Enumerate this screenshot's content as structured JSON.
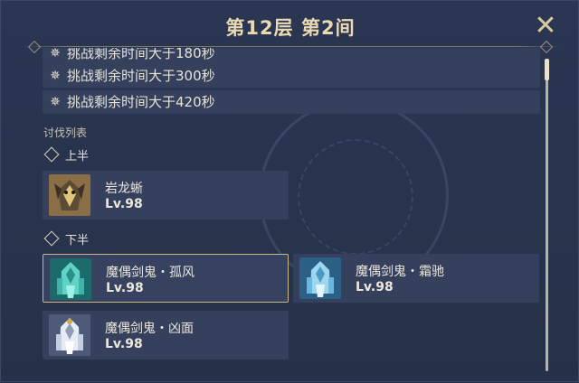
{
  "header": {
    "title": "第12层 第2间",
    "close_icon": "close-icon"
  },
  "conditions": [
    {
      "text": "挑战剩余时间大于180秒",
      "icon": "star-icon"
    },
    {
      "text": "挑战剩余时间大于300秒",
      "icon": "star-icon"
    },
    {
      "text": "挑战剩余时间大于420秒",
      "icon": "star-icon"
    }
  ],
  "enemy_list": {
    "title": "讨伐列表",
    "first_half": {
      "label": "上半",
      "enemies": [
        {
          "name": "岩龙蜥",
          "level": "Lv.98",
          "portrait": "geovishap-portrait"
        }
      ]
    },
    "second_half": {
      "label": "下半",
      "enemies": [
        {
          "name": "魔偶剑鬼・孤风",
          "level": "Lv.98",
          "portrait": "maguu-kenki-lone-gale-portrait",
          "selected": true
        },
        {
          "name": "魔偶剑鬼・霜驰",
          "level": "Lv.98",
          "portrait": "maguu-kenki-frostwind-portrait"
        },
        {
          "name": "魔偶剑鬼・凶面",
          "level": "Lv.98",
          "portrait": "maguu-kenki-mask-portrait"
        }
      ]
    }
  },
  "colors": {
    "background": "#263149",
    "panel": "#34405c",
    "title_gold": "#ead9b2",
    "selected_border": "#c9b787"
  }
}
